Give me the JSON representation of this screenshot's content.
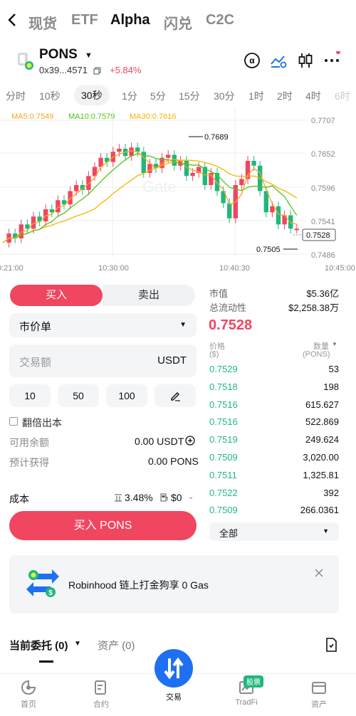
{
  "nav": {
    "tabs": [
      "现货",
      "ETF",
      "Alpha",
      "闪兑",
      "C2C"
    ],
    "active_index": 2
  },
  "token": {
    "name": "PONS",
    "address": "0x39...4571",
    "change": "+5.84%"
  },
  "intervals": [
    "分时",
    "10秒",
    "30秒",
    "1分",
    "5分",
    "15分",
    "30分",
    "1时",
    "2时",
    "4时",
    "6时"
  ],
  "active_interval": "30秒",
  "ma": {
    "ma5": "MA5:0.7549",
    "ma10": "MA10:0.7579",
    "ma30": "MA30:0.7616"
  },
  "chart_data": {
    "type": "candlestick",
    "y_ticks": [
      "0.7707",
      "0.7652",
      "0.7596",
      "0.7541",
      "0.7486"
    ],
    "x_ticks": [
      "0:21:00",
      "10:30:00",
      "10:40:30",
      "10:45:00"
    ],
    "annotations": {
      "high": "0.7689",
      "low": "0.7505",
      "current": "0.7528"
    },
    "watermark": "Gate"
  },
  "trade": {
    "buy_tab": "买入",
    "sell_tab": "卖出",
    "order_type": "市价单",
    "amount_placeholder": "交易额",
    "amount_unit": "USDT",
    "quick": [
      "10",
      "50",
      "100"
    ],
    "double_label": "翻倍出本",
    "available_label": "可用余额",
    "available_value": "0.00 USDT",
    "estimate_label": "预计获得",
    "estimate_value": "0.00 PONS",
    "cost_label": "成本",
    "cost_pct": "3.48%",
    "cost_fee": "$0",
    "buy_button": "买入 PONS"
  },
  "market": {
    "cap_label": "市值",
    "cap_value": "$5.36亿",
    "liq_label": "总流动性",
    "liq_value": "$2,258.38万",
    "price": "0.7528",
    "price_col": "价格",
    "price_unit": "($)",
    "qty_col": "数量",
    "qty_unit": "(PONS)",
    "rows": [
      {
        "price": "0.7529",
        "qty": "53"
      },
      {
        "price": "0.7518",
        "qty": "198"
      },
      {
        "price": "0.7516",
        "qty": "615.627"
      },
      {
        "price": "0.7516",
        "qty": "522.869"
      },
      {
        "price": "0.7519",
        "qty": "249.624"
      },
      {
        "price": "0.7509",
        "qty": "3,020.00"
      },
      {
        "price": "0.7511",
        "qty": "1,325.81"
      },
      {
        "price": "0.7522",
        "qty": "392"
      },
      {
        "price": "0.7509",
        "qty": "266.0361"
      }
    ],
    "filter": "全部"
  },
  "banner": {
    "text": "Robinhood 链上打金狗享 0 Gas"
  },
  "orders": {
    "current": "当前委托 (0)",
    "assets": "资产 (0)"
  },
  "bottom": {
    "tabs": [
      "首页",
      "合约",
      "交易",
      "TradFi",
      "资产"
    ],
    "badge": "股票"
  },
  "colors": {
    "up": "#f0465f",
    "down": "#1fb87c",
    "ma5": "#f5a623",
    "ma10": "#52c41a",
    "ma30": "#f5b400",
    "accent": "#1f6ff2"
  }
}
